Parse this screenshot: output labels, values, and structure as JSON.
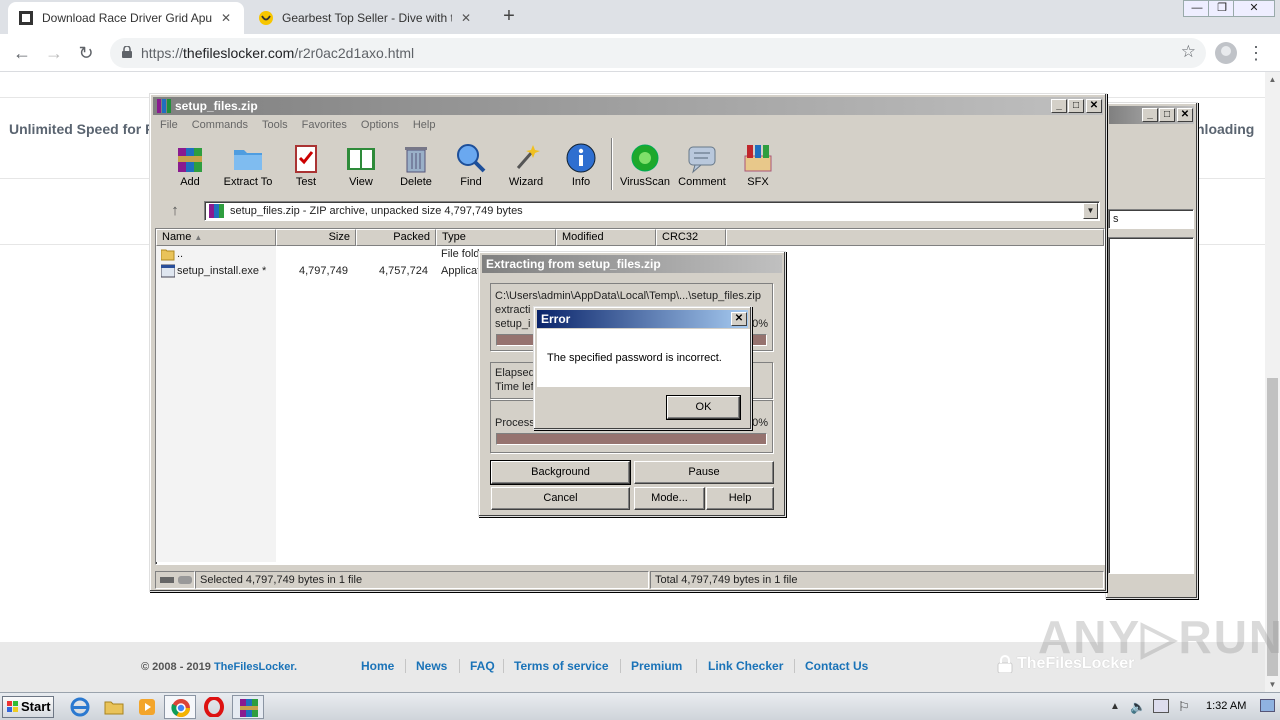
{
  "browser": {
    "tabs": [
      {
        "title": "Download Race Driver Grid Apun Ka",
        "active": true
      },
      {
        "title": "Gearbest Top Seller - Dive with the C",
        "active": false
      }
    ],
    "url_host": "thefileslocker.com",
    "url_path": "/r2r0ac2d1axo.html",
    "url_scheme": "https://",
    "window_buttons": {
      "minimize": "—",
      "restore": "❐",
      "close": "✕"
    }
  },
  "page": {
    "banner_left": "Unlimited Speed for P",
    "banner_right": "nloading",
    "footer": {
      "copyright_prefix": "© 2008 - 2019 ",
      "brand": "TheFilesLocker.",
      "links": [
        "Home",
        "News",
        "FAQ",
        "Terms of service",
        "Premium",
        "Link Checker",
        "Contact Us"
      ],
      "logo_text": "TheFilesLocker"
    },
    "watermark": "ANY▷RUN"
  },
  "winrar": {
    "title": "setup_files.zip",
    "menu": [
      "File",
      "Commands",
      "Tools",
      "Favorites",
      "Options",
      "Help"
    ],
    "toolbar": [
      "Add",
      "Extract To",
      "Test",
      "View",
      "Delete",
      "Find",
      "Wizard",
      "Info",
      "VirusScan",
      "Comment",
      "SFX"
    ],
    "address": "setup_files.zip - ZIP archive, unpacked size 4,797,749 bytes",
    "columns": [
      "Name",
      "Size",
      "Packed",
      "Type",
      "Modified",
      "CRC32"
    ],
    "rows": [
      {
        "name": "..",
        "size": "",
        "packed": "",
        "type": "File fold"
      },
      {
        "name": "setup_install.exe *",
        "size": "4,797,749",
        "packed": "4,757,724",
        "type": "Applicat"
      }
    ],
    "status_left": "Selected 4,797,749 bytes in 1 file",
    "status_right": "Total 4,797,749 bytes in 1 file",
    "bg_window_combo": "s"
  },
  "extract_dialog": {
    "title": "Extracting from setup_files.zip",
    "path": "C:\\Users\\admin\\AppData\\Local\\Temp\\...\\setup_files.zip",
    "line2": "extracti",
    "line3": "setup_i",
    "pct1": "0%",
    "elapsed": "Elapsed",
    "time_left": "Time lef",
    "processed": "Process",
    "pct2": "0%",
    "buttons": {
      "background": "Background",
      "pause": "Pause",
      "cancel": "Cancel",
      "mode": "Mode...",
      "help": "Help"
    }
  },
  "error_dialog": {
    "title": "Error",
    "message": "The specified password is incorrect.",
    "ok": "OK"
  },
  "taskbar": {
    "start": "Start",
    "clock": "1:32 AM"
  }
}
